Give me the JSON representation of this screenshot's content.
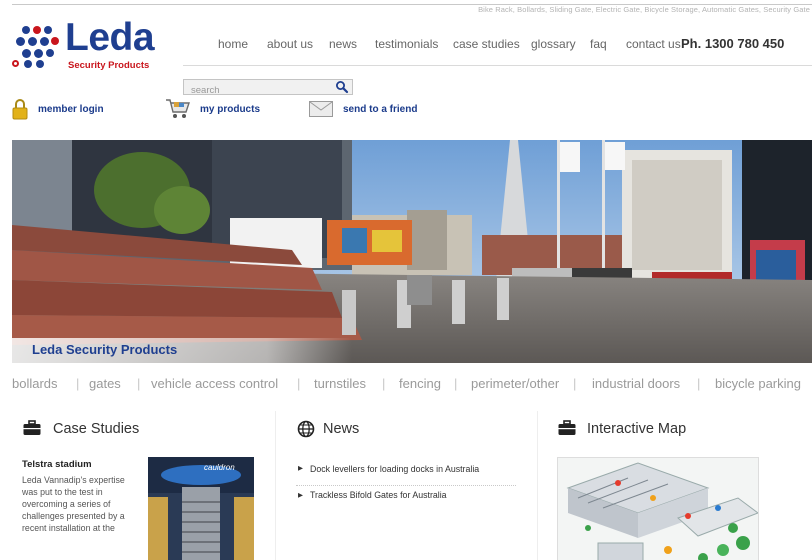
{
  "header": {
    "tagline": "Bike Rack, Bollards, Sliding Gate, Electric Gate, Bicycle Storage, Automatic Gates, Security Gate",
    "logo_word": "Leda",
    "logo_sub": "Security Products",
    "phone": "Ph. 1300 780 450"
  },
  "nav": [
    "home",
    "about us",
    "news",
    "testimonials",
    "case studies",
    "glossary",
    "faq",
    "contact us"
  ],
  "search": {
    "placeholder": "search"
  },
  "utility": {
    "member_login": "member login",
    "my_products": "my products",
    "send_to_friend": "send to a friend"
  },
  "hero": {
    "caption": "Leda Security Products"
  },
  "categories": [
    "bollards",
    "gates",
    "vehicle access control",
    "turnstiles",
    "fencing",
    "perimeter/other",
    "industrial doors",
    "bicycle parking"
  ],
  "case_studies": {
    "heading": "Case Studies",
    "item_title": "Telstra stadium",
    "item_body": "Leda Vannadip's expertise was put to the test in overcoming a series of challenges presented by a recent installation at the",
    "image_sign": "cauldron"
  },
  "news": {
    "heading": "News",
    "items": [
      "Dock levellers for loading docks in Australia",
      "Trackless Bifold Gates for Australia"
    ]
  },
  "map": {
    "heading": "Interactive Map"
  },
  "colors": {
    "brand_blue": "#1f3f90",
    "brand_red": "#c9161d",
    "link_blue": "#1b3b8b"
  }
}
